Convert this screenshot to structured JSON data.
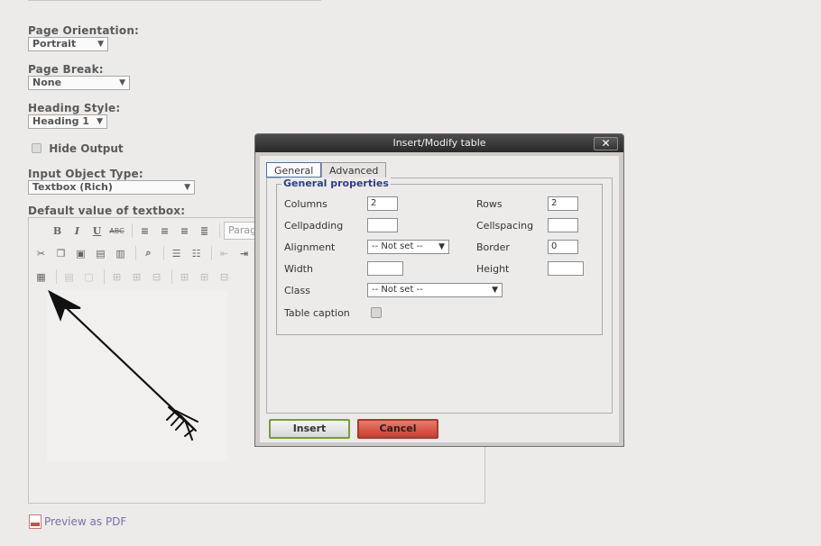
{
  "form": {
    "page_orientation": {
      "label": "Page Orientation:",
      "value": "Portrait"
    },
    "page_break": {
      "label": "Page Break:",
      "value": "None"
    },
    "heading_style": {
      "label": "Heading Style:",
      "value": "Heading 1"
    },
    "hide_output": {
      "label": "Hide Output",
      "checked": false
    },
    "input_object_type": {
      "label": "Input Object Type:",
      "value": "Textbox (Rich)"
    },
    "default_value": {
      "label": "Default value of textbox:"
    }
  },
  "editor": {
    "toolbar_row1": [
      "bold-icon",
      "italic-icon",
      "underline-icon",
      "strikethrough-icon",
      "align-left-icon",
      "align-center-icon",
      "align-right-icon",
      "align-justify-icon"
    ],
    "paragraph_select": "Parag",
    "toolbar_row2": [
      "cut-icon",
      "copy-icon",
      "paste-icon",
      "paste-text-icon",
      "paste-word-icon",
      "find-icon",
      "bullet-list-icon",
      "numbered-list-icon",
      "outdent-icon",
      "indent-icon"
    ],
    "toolbar_row3": [
      "table-icon",
      "row-props-icon",
      "cell-props-icon",
      "insert-row-before-icon",
      "insert-row-after-icon",
      "delete-row-icon",
      "insert-col-before-icon",
      "insert-col-after-icon",
      "delete-col-icon"
    ],
    "glyphs": {
      "bold": "B",
      "italic": "I",
      "underline": "U",
      "strike": "ABC"
    }
  },
  "preview_link": "Preview as PDF",
  "dialog": {
    "title": "Insert/Modify table",
    "close_glyph": "✕",
    "tabs": [
      {
        "label": "General",
        "active": true
      },
      {
        "label": "Advanced",
        "active": false
      }
    ],
    "legend": "General properties",
    "fields": {
      "columns": {
        "label": "Columns",
        "value": "2"
      },
      "rows": {
        "label": "Rows",
        "value": "2"
      },
      "cellpadding": {
        "label": "Cellpadding",
        "value": ""
      },
      "cellspacing": {
        "label": "Cellspacing",
        "value": ""
      },
      "alignment": {
        "label": "Alignment",
        "value": "-- Not set --"
      },
      "border": {
        "label": "Border",
        "value": "0"
      },
      "width": {
        "label": "Width",
        "value": ""
      },
      "height": {
        "label": "Height",
        "value": ""
      },
      "class": {
        "label": "Class",
        "value": "-- Not set --"
      },
      "table_caption": {
        "label": "Table caption",
        "checked": false
      }
    },
    "insert_label": "Insert",
    "cancel_label": "Cancel"
  },
  "colors": {
    "accent_blue": "#2b3f8a",
    "insert_border": "#7a9a3c",
    "cancel_red": "#c9402f",
    "titlebar": "#2a2a2a"
  }
}
